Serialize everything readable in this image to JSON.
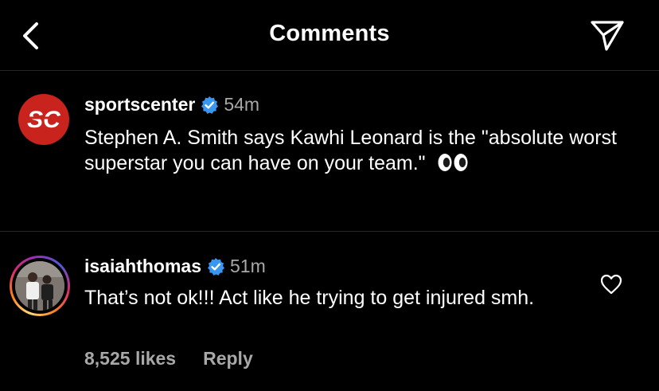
{
  "header": {
    "title": "Comments"
  },
  "caption": {
    "username": "sportscenter",
    "time": "54m",
    "text": "Stephen A. Smith says Kawhi Leonard is the \"absolute worst superstar you can have on your team.\"",
    "avatar_text": "SC"
  },
  "comment": {
    "username": "isaiahthomas",
    "time": "51m",
    "text": "That’s not ok!!! Act like he trying to get injured smh.",
    "likes": "8,525 likes",
    "reply_label": "Reply"
  },
  "colors": {
    "verified": "#3897f0",
    "background": "#000000",
    "muted": "#a8a8a8",
    "espn_red": "#c8231c"
  },
  "icons": [
    "back-arrow-icon",
    "paper-plane-icon",
    "verified-badge-icon",
    "eyes-emoji-icon",
    "heart-icon"
  ]
}
